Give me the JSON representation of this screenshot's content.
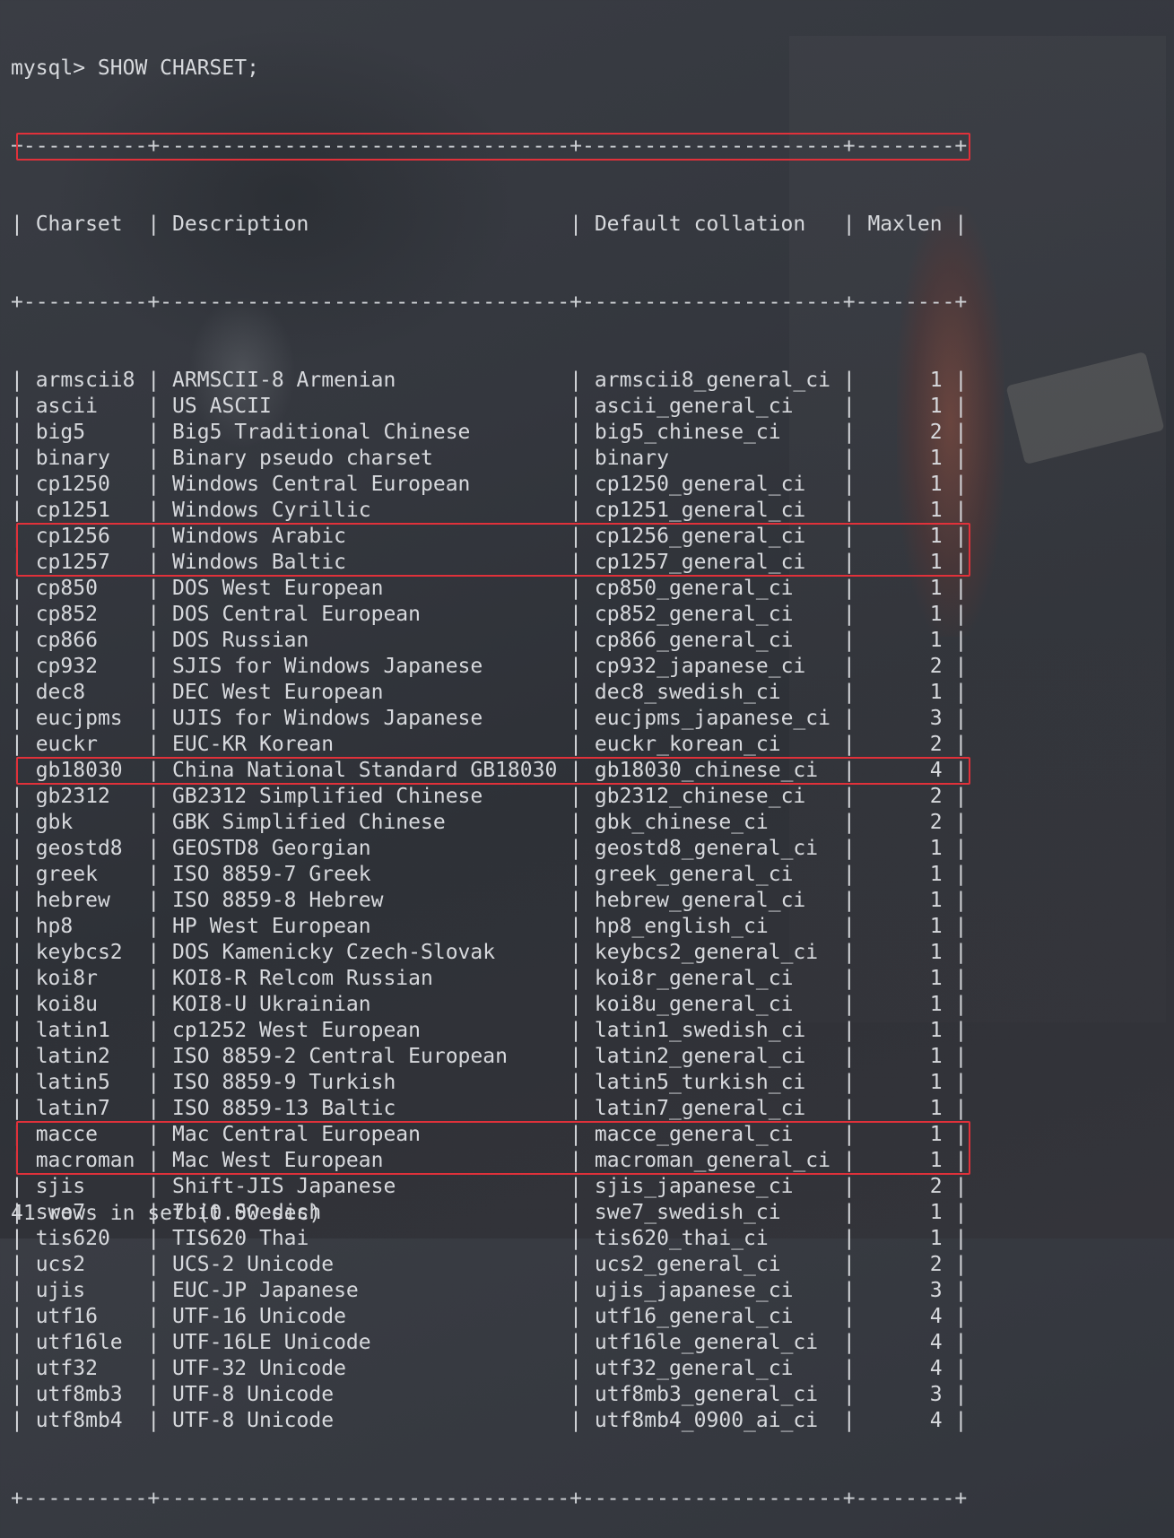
{
  "prompt": "mysql> SHOW CHARSET;",
  "columns": [
    "Charset",
    "Description",
    "Default collation",
    "Maxlen"
  ],
  "rows": [
    [
      "armscii8",
      "ARMSCII-8 Armenian",
      "armscii8_general_ci",
      "1"
    ],
    [
      "ascii",
      "US ASCII",
      "ascii_general_ci",
      "1"
    ],
    [
      "big5",
      "Big5 Traditional Chinese",
      "big5_chinese_ci",
      "2"
    ],
    [
      "binary",
      "Binary pseudo charset",
      "binary",
      "1"
    ],
    [
      "cp1250",
      "Windows Central European",
      "cp1250_general_ci",
      "1"
    ],
    [
      "cp1251",
      "Windows Cyrillic",
      "cp1251_general_ci",
      "1"
    ],
    [
      "cp1256",
      "Windows Arabic",
      "cp1256_general_ci",
      "1"
    ],
    [
      "cp1257",
      "Windows Baltic",
      "cp1257_general_ci",
      "1"
    ],
    [
      "cp850",
      "DOS West European",
      "cp850_general_ci",
      "1"
    ],
    [
      "cp852",
      "DOS Central European",
      "cp852_general_ci",
      "1"
    ],
    [
      "cp866",
      "DOS Russian",
      "cp866_general_ci",
      "1"
    ],
    [
      "cp932",
      "SJIS for Windows Japanese",
      "cp932_japanese_ci",
      "2"
    ],
    [
      "dec8",
      "DEC West European",
      "dec8_swedish_ci",
      "1"
    ],
    [
      "eucjpms",
      "UJIS for Windows Japanese",
      "eucjpms_japanese_ci",
      "3"
    ],
    [
      "euckr",
      "EUC-KR Korean",
      "euckr_korean_ci",
      "2"
    ],
    [
      "gb18030",
      "China National Standard GB18030",
      "gb18030_chinese_ci",
      "4"
    ],
    [
      "gb2312",
      "GB2312 Simplified Chinese",
      "gb2312_chinese_ci",
      "2"
    ],
    [
      "gbk",
      "GBK Simplified Chinese",
      "gbk_chinese_ci",
      "2"
    ],
    [
      "geostd8",
      "GEOSTD8 Georgian",
      "geostd8_general_ci",
      "1"
    ],
    [
      "greek",
      "ISO 8859-7 Greek",
      "greek_general_ci",
      "1"
    ],
    [
      "hebrew",
      "ISO 8859-8 Hebrew",
      "hebrew_general_ci",
      "1"
    ],
    [
      "hp8",
      "HP West European",
      "hp8_english_ci",
      "1"
    ],
    [
      "keybcs2",
      "DOS Kamenicky Czech-Slovak",
      "keybcs2_general_ci",
      "1"
    ],
    [
      "koi8r",
      "KOI8-R Relcom Russian",
      "koi8r_general_ci",
      "1"
    ],
    [
      "koi8u",
      "KOI8-U Ukrainian",
      "koi8u_general_ci",
      "1"
    ],
    [
      "latin1",
      "cp1252 West European",
      "latin1_swedish_ci",
      "1"
    ],
    [
      "latin2",
      "ISO 8859-2 Central European",
      "latin2_general_ci",
      "1"
    ],
    [
      "latin5",
      "ISO 8859-9 Turkish",
      "latin5_turkish_ci",
      "1"
    ],
    [
      "latin7",
      "ISO 8859-13 Baltic",
      "latin7_general_ci",
      "1"
    ],
    [
      "macce",
      "Mac Central European",
      "macce_general_ci",
      "1"
    ],
    [
      "macroman",
      "Mac West European",
      "macroman_general_ci",
      "1"
    ],
    [
      "sjis",
      "Shift-JIS Japanese",
      "sjis_japanese_ci",
      "2"
    ],
    [
      "swe7",
      "7bit Swedish",
      "swe7_swedish_ci",
      "1"
    ],
    [
      "tis620",
      "TIS620 Thai",
      "tis620_thai_ci",
      "1"
    ],
    [
      "ucs2",
      "UCS-2 Unicode",
      "ucs2_general_ci",
      "2"
    ],
    [
      "ujis",
      "EUC-JP Japanese",
      "ujis_japanese_ci",
      "3"
    ],
    [
      "utf16",
      "UTF-16 Unicode",
      "utf16_general_ci",
      "4"
    ],
    [
      "utf16le",
      "UTF-16LE Unicode",
      "utf16le_general_ci",
      "4"
    ],
    [
      "utf32",
      "UTF-32 Unicode",
      "utf32_general_ci",
      "4"
    ],
    [
      "utf8mb3",
      "UTF-8 Unicode",
      "utf8mb3_general_ci",
      "3"
    ],
    [
      "utf8mb4",
      "UTF-8 Unicode",
      "utf8mb4_0900_ai_ci",
      "4"
    ]
  ],
  "footer": "41 rows in set (0.00 sec)",
  "highlighted_row_groups": [
    [
      1
    ],
    [
      16,
      17
    ],
    [
      25
    ],
    [
      39,
      40
    ]
  ],
  "highlight_color": "#e0313a",
  "text_color": "#d7d9dd"
}
